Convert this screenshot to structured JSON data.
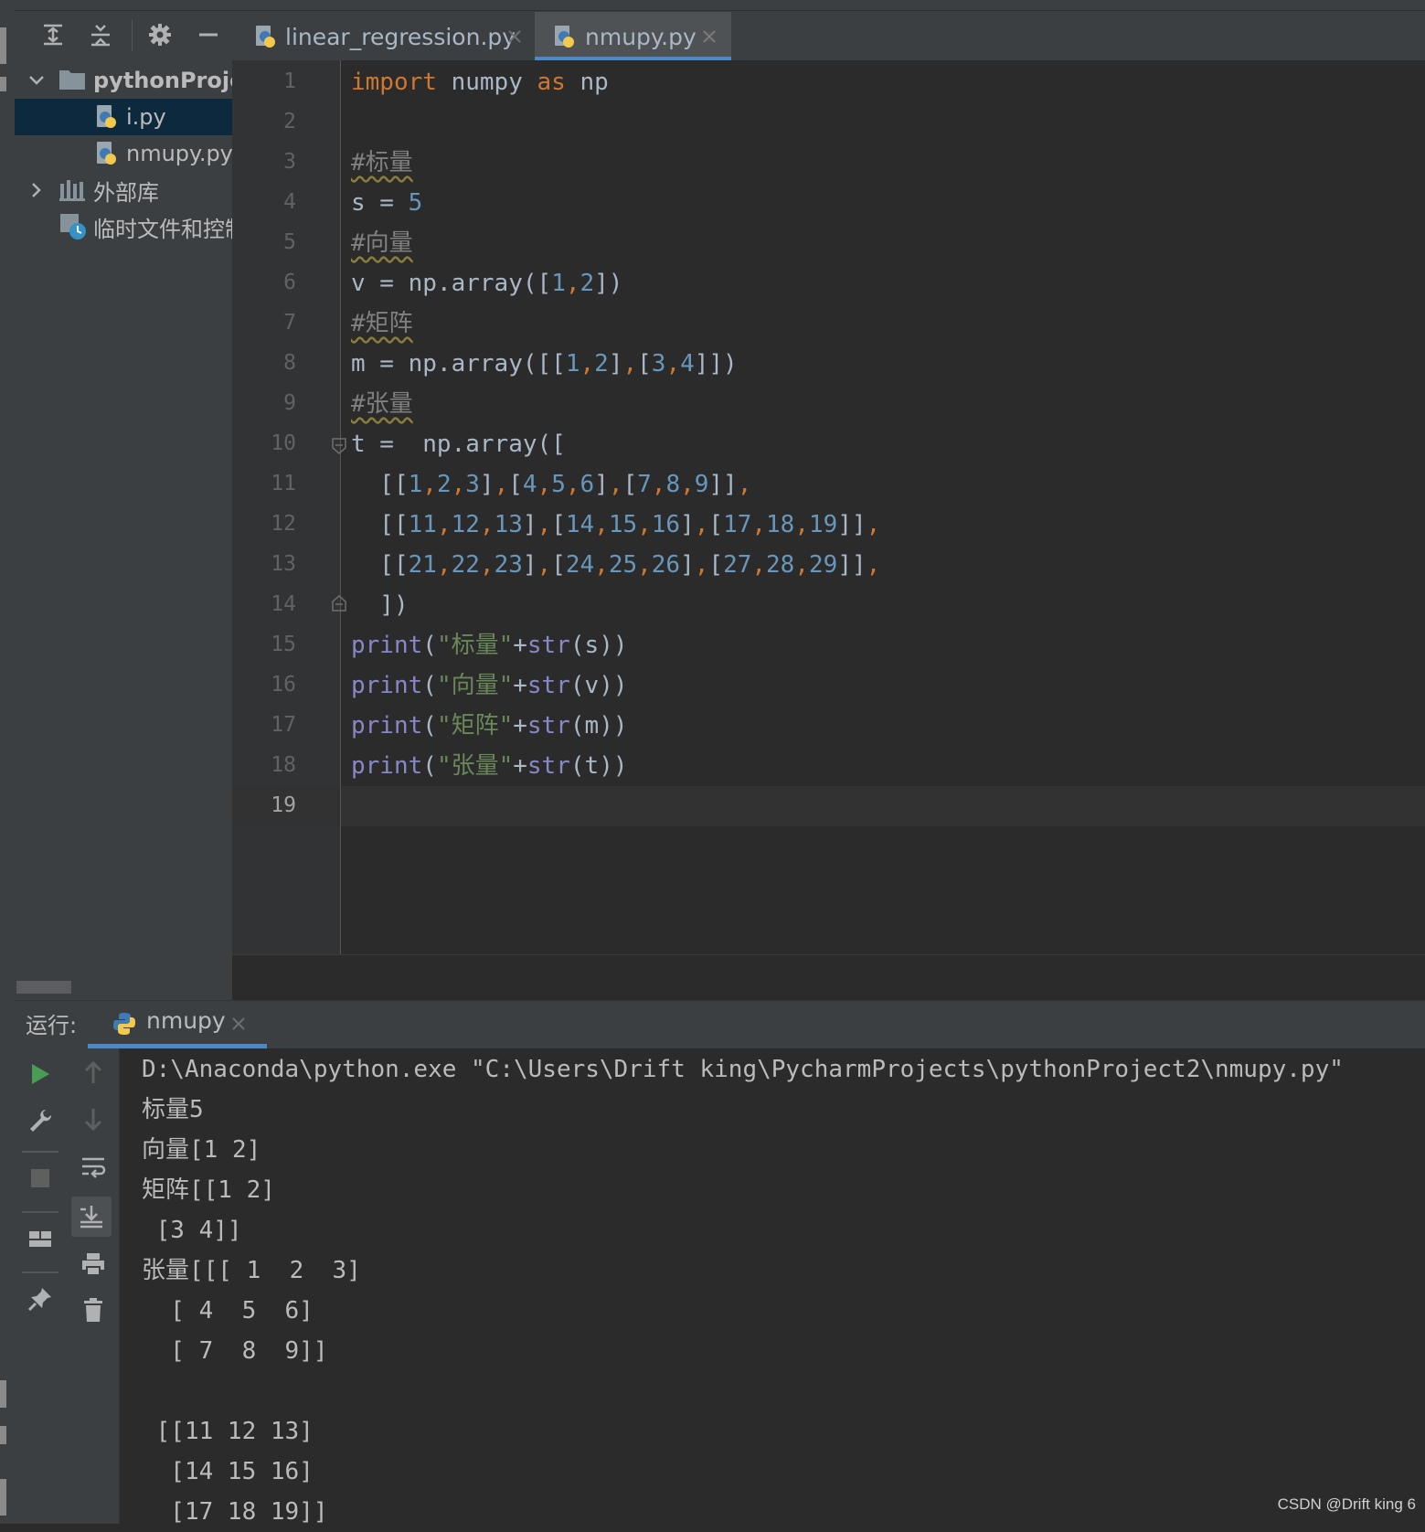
{
  "toolbar": {
    "icons": [
      "expand-all-icon",
      "collapse-all-icon",
      "gear-icon",
      "minimize-icon"
    ]
  },
  "tabs": [
    {
      "label": "linear_regression.py",
      "active": false
    },
    {
      "label": "nmupy.py",
      "active": true
    }
  ],
  "project_tree": [
    {
      "label": "pythonProje",
      "type": "folder",
      "expanded": true
    },
    {
      "label": "i.py",
      "type": "python-file",
      "selected": true
    },
    {
      "label": "nmupy.py",
      "type": "python-file"
    },
    {
      "label": "外部库",
      "type": "library",
      "expanded": false
    },
    {
      "label": "临时文件和控制",
      "type": "scratches"
    }
  ],
  "editor": {
    "line_numbers": [
      "1",
      "2",
      "3",
      "4",
      "5",
      "6",
      "7",
      "8",
      "9",
      "10",
      "11",
      "12",
      "13",
      "14",
      "15",
      "16",
      "17",
      "18",
      "19"
    ],
    "current_line": "19",
    "code": [
      "import numpy as np",
      "",
      "#标量",
      "s = 5",
      "#向量",
      "v = np.array([1,2])",
      "#矩阵",
      "m = np.array([[1,2],[3,4]])",
      "#张量",
      "t =  np.array([",
      "  [[1,2,3],[4,5,6],[7,8,9]],",
      "  [[11,12,13],[14,15,16],[17,18,19]],",
      "  [[21,22,23],[24,25,26],[27,28,29]],",
      "  ])",
      "print(\"标量\"+str(s))",
      "print(\"向量\"+str(v))",
      "print(\"矩阵\"+str(m))",
      "print(\"张量\"+str(t))",
      ""
    ]
  },
  "run": {
    "label": "运行:",
    "tab_label": "nmupy",
    "output": [
      "D:\\Anaconda\\python.exe \"C:\\Users\\Drift king\\PycharmProjects\\pythonProject2\\nmupy.py\"",
      "标量5",
      "向量[1 2]",
      "矩阵[[1 2]",
      " [3 4]]",
      "张量[[[ 1  2  3]",
      "  [ 4  5  6]",
      "  [ 7  8  9]]",
      "",
      " [[11 12 13]",
      "  [14 15 16]",
      "  [17 18 19]]"
    ]
  },
  "watermark": "CSDN @Drift king 6",
  "colors": {
    "keyword": "#cc7832",
    "number": "#6897bb",
    "string": "#6a8759",
    "comment": "#808080",
    "builtin": "#8888c6",
    "accent": "#4a88c7",
    "run_green": "#499c54"
  }
}
